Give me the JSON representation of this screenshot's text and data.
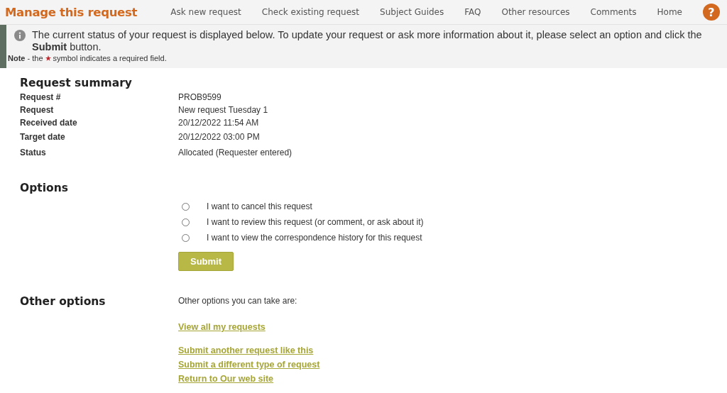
{
  "header": {
    "title": "Manage this request",
    "nav": [
      {
        "label": "Ask new request"
      },
      {
        "label": "Check existing request"
      },
      {
        "label": "Subject Guides"
      },
      {
        "label": "FAQ"
      },
      {
        "label": "Other resources"
      },
      {
        "label": "Comments"
      },
      {
        "label": "Home"
      }
    ],
    "help": "?"
  },
  "notice": {
    "message": "The current status of your request is displayed below. To update your request or ask more information about it, please select an option and click the **Submit** button.",
    "note_prefix": "**Note** - the",
    "note_suffix": "symbol indicates a required field."
  },
  "summary": {
    "heading": "Request summary",
    "fields": [
      {
        "label": "Request #",
        "value": "PROB9599"
      },
      {
        "label": "Request",
        "value": "New request Tuesday 1"
      },
      {
        "label": "Received date",
        "value": "20/12/2022 11:54 AM"
      },
      {
        "label": "Target date",
        "value": "20/12/2022 03:00 PM"
      },
      {
        "label": "Status",
        "value": "Allocated (Requester entered)"
      }
    ]
  },
  "options": {
    "heading": "Options",
    "choices": [
      {
        "label": "I want to cancel this request",
        "selected": false
      },
      {
        "label": "I want to review this request (or comment, or ask about it)",
        "selected": false
      },
      {
        "label": "I want to view the correspondence history for this request",
        "selected": false
      }
    ],
    "submit": "Submit"
  },
  "other_options": {
    "heading": "Other options",
    "intro": "Other options you can take are:",
    "links": [
      {
        "label": "View all my requests"
      },
      {
        "label": "Submit another request like this"
      },
      {
        "label": "Submit a different type of request"
      },
      {
        "label": "Return to Our web site"
      }
    ]
  }
}
